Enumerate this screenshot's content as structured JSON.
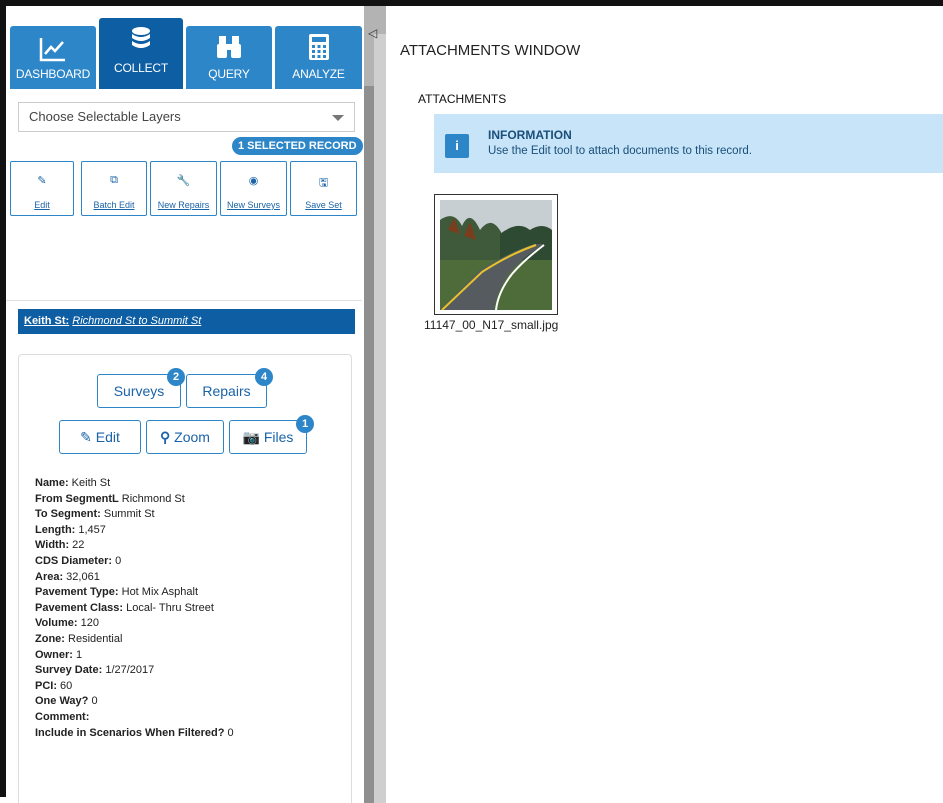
{
  "nav": {
    "tabs": [
      {
        "label": "DASHBOARD",
        "icon": "line-chart-icon"
      },
      {
        "label": "COLLECT",
        "icon": "database-icon"
      },
      {
        "label": "QUERY",
        "icon": "binoculars-icon"
      },
      {
        "label": "ANALYZE",
        "icon": "calculator-icon"
      }
    ]
  },
  "layers": {
    "selected": "Choose Selectable Layers"
  },
  "selection": {
    "badge": "1 SELECTED RECORD"
  },
  "tools": [
    {
      "label": "Edit",
      "icon": "edit-icon"
    },
    {
      "label": "Batch Edit",
      "icon": "copy-icon"
    },
    {
      "label": "New Repairs",
      "icon": "wrench-icon"
    },
    {
      "label": "New Surveys",
      "icon": "eye-icon"
    },
    {
      "label": "Save Set",
      "icon": "save-icon"
    }
  ],
  "record": {
    "street": "Keith St:",
    "segment": "Richmond St to Summit St"
  },
  "actions": {
    "surveys": {
      "label": "Surveys",
      "count": "2"
    },
    "repairs": {
      "label": "Repairs",
      "count": "4"
    },
    "edit": {
      "label": "Edit"
    },
    "zoom": {
      "label": "Zoom"
    },
    "files": {
      "label": "Files",
      "count": "1"
    }
  },
  "properties": [
    {
      "key": "Name:",
      "value": " Keith St"
    },
    {
      "key": "From SegmentL",
      "value": " Richmond St"
    },
    {
      "key": "To Segment:",
      "value": " Summit St"
    },
    {
      "key": "Length:",
      "value": " 1,457"
    },
    {
      "key": "Width:",
      "value": " 22"
    },
    {
      "key": "CDS Diameter:",
      "value": " 0"
    },
    {
      "key": "Area:",
      "value": " 32,061"
    },
    {
      "key": "Pavement Type:",
      "value": " Hot Mix Asphalt"
    },
    {
      "key": "Pavement Class:",
      "value": " Local- Thru Street"
    },
    {
      "key": "Volume:",
      "value": " 120"
    },
    {
      "key": "Zone:",
      "value": " Residential"
    },
    {
      "key": "Owner:",
      "value": " 1"
    },
    {
      "key": "Survey Date:",
      "value": " 1/27/2017"
    },
    {
      "key": "PCI:",
      "value": " 60"
    },
    {
      "key": "One Way?",
      "value": " 0"
    },
    {
      "key": "Comment:",
      "value": ""
    },
    {
      "key": "Include in Scenarios When Filtered?",
      "value": " 0"
    }
  ],
  "attachments": {
    "window_title": "ATTACHMENTS WINDOW",
    "section_title": "ATTACHMENTS",
    "info_title": "INFORMATION",
    "info_text": "Use the Edit tool to attach documents to this record.",
    "file_name": "11147_00_N17_small.jpg"
  },
  "colors": {
    "primary": "#2d86c8",
    "primary_dark": "#0e5ea3",
    "info_bg": "#c7e4f8"
  }
}
